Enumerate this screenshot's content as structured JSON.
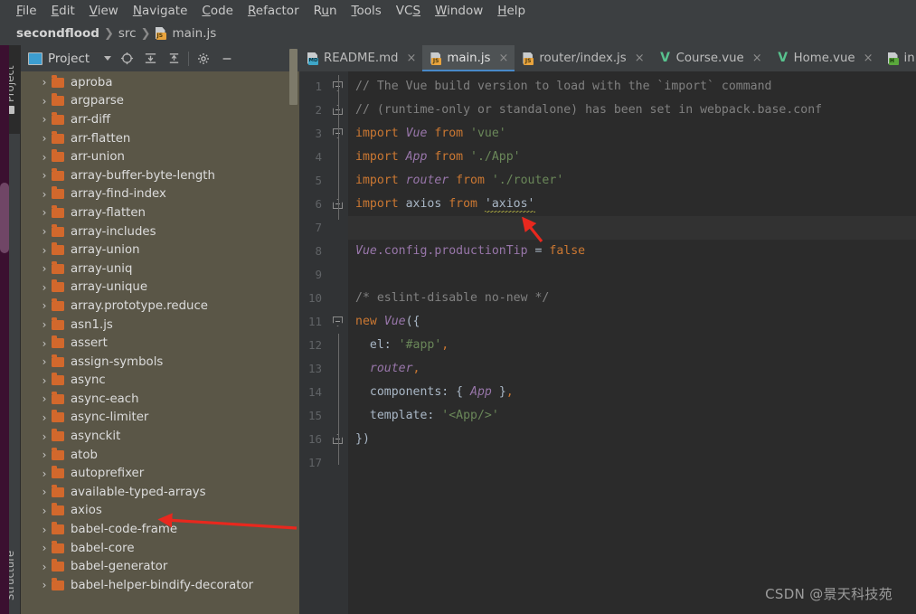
{
  "window": {
    "theme_bg": "#3c3f41",
    "editor_bg": "#2b2b2b",
    "accent": "#4989c8"
  },
  "menubar": {
    "items": [
      {
        "label": "File",
        "accel": "F"
      },
      {
        "label": "Edit",
        "accel": "E"
      },
      {
        "label": "View",
        "accel": "V"
      },
      {
        "label": "Navigate",
        "accel": "N"
      },
      {
        "label": "Code",
        "accel": "C"
      },
      {
        "label": "Refactor",
        "accel": "R"
      },
      {
        "label": "Run",
        "accel": "u"
      },
      {
        "label": "Tools",
        "accel": "T"
      },
      {
        "label": "VCS",
        "accel": "S"
      },
      {
        "label": "Window",
        "accel": "W"
      },
      {
        "label": "Help",
        "accel": "H"
      }
    ]
  },
  "breadcrumb": {
    "project": "secondflood",
    "folder": "src",
    "file": "main.js",
    "file_icon": "js-file-icon",
    "separator": "❯"
  },
  "toolwindow_strip": {
    "project_tab": "Project",
    "structure_tab": "Structure"
  },
  "project_panel": {
    "title": "Project",
    "toolbar_icons": [
      "select-opened-file-icon",
      "expand-all-icon",
      "collapse-all-icon",
      "settings-gear-icon",
      "hide-panel-icon"
    ],
    "tree": [
      {
        "label": "aproba",
        "icon": "folder-icon",
        "expanded": false
      },
      {
        "label": "argparse",
        "icon": "folder-icon",
        "expanded": false
      },
      {
        "label": "arr-diff",
        "icon": "folder-icon",
        "expanded": false
      },
      {
        "label": "arr-flatten",
        "icon": "folder-icon",
        "expanded": false
      },
      {
        "label": "arr-union",
        "icon": "folder-icon",
        "expanded": false
      },
      {
        "label": "array-buffer-byte-length",
        "icon": "folder-icon",
        "expanded": false
      },
      {
        "label": "array-find-index",
        "icon": "folder-icon",
        "expanded": false
      },
      {
        "label": "array-flatten",
        "icon": "folder-icon",
        "expanded": false
      },
      {
        "label": "array-includes",
        "icon": "folder-icon",
        "expanded": false
      },
      {
        "label": "array-union",
        "icon": "folder-icon",
        "expanded": false
      },
      {
        "label": "array-uniq",
        "icon": "folder-icon",
        "expanded": false
      },
      {
        "label": "array-unique",
        "icon": "folder-icon",
        "expanded": false
      },
      {
        "label": "array.prototype.reduce",
        "icon": "folder-icon",
        "expanded": false
      },
      {
        "label": "asn1.js",
        "icon": "folder-icon",
        "expanded": false
      },
      {
        "label": "assert",
        "icon": "folder-icon",
        "expanded": false
      },
      {
        "label": "assign-symbols",
        "icon": "folder-icon",
        "expanded": false
      },
      {
        "label": "async",
        "icon": "folder-icon",
        "expanded": false
      },
      {
        "label": "async-each",
        "icon": "folder-icon",
        "expanded": false
      },
      {
        "label": "async-limiter",
        "icon": "folder-icon",
        "expanded": false
      },
      {
        "label": "asynckit",
        "icon": "folder-icon",
        "expanded": false
      },
      {
        "label": "atob",
        "icon": "folder-icon",
        "expanded": false
      },
      {
        "label": "autoprefixer",
        "icon": "folder-icon",
        "expanded": false
      },
      {
        "label": "available-typed-arrays",
        "icon": "folder-icon",
        "expanded": false
      },
      {
        "label": "axios",
        "icon": "folder-icon",
        "expanded": false
      },
      {
        "label": "babel-code-frame",
        "icon": "folder-icon",
        "expanded": false
      },
      {
        "label": "babel-core",
        "icon": "folder-icon",
        "expanded": false
      },
      {
        "label": "babel-generator",
        "icon": "folder-icon",
        "expanded": false
      },
      {
        "label": "babel-helper-bindify-decorator",
        "icon": "folder-icon",
        "expanded": false
      }
    ]
  },
  "editor_tabs": [
    {
      "label": "README.md",
      "icon": "md-file-icon",
      "active": false,
      "closable": true
    },
    {
      "label": "main.js",
      "icon": "js-file-icon",
      "active": true,
      "closable": true
    },
    {
      "label": "router/index.js",
      "icon": "js-file-icon",
      "active": false,
      "closable": true
    },
    {
      "label": "Course.vue",
      "icon": "vue-file-icon",
      "active": false,
      "closable": true
    },
    {
      "label": "Home.vue",
      "icon": "vue-file-icon",
      "active": false,
      "closable": true
    },
    {
      "label": "in",
      "icon": "html-file-icon",
      "active": false,
      "closable": false
    }
  ],
  "code": {
    "line_numbers": [
      "1",
      "2",
      "3",
      "4",
      "5",
      "6",
      "7",
      "8",
      "9",
      "10",
      "11",
      "12",
      "13",
      "14",
      "15",
      "16",
      "17"
    ],
    "current_line": 7,
    "lines": [
      {
        "n": 1,
        "fold": "arrow-dn",
        "tokens": [
          {
            "t": "// The Vue build version to load with the `import` command",
            "c": "t-com"
          }
        ]
      },
      {
        "n": 2,
        "fold": "arrow-up",
        "tokens": [
          {
            "t": "// (runtime-only or standalone) has been set in webpack.base.conf ",
            "c": "t-com"
          }
        ]
      },
      {
        "n": 3,
        "fold": "arrow-dn",
        "tokens": [
          {
            "t": "import ",
            "c": "t-kw"
          },
          {
            "t": "Vue",
            "c": "t-cls"
          },
          {
            "t": " from ",
            "c": "t-kw"
          },
          {
            "t": "'vue'",
            "c": "t-str"
          }
        ]
      },
      {
        "n": 4,
        "fold": "",
        "tokens": [
          {
            "t": "import ",
            "c": "t-kw"
          },
          {
            "t": "App",
            "c": "t-cls"
          },
          {
            "t": " from ",
            "c": "t-kw"
          },
          {
            "t": "'./App'",
            "c": "t-str"
          }
        ]
      },
      {
        "n": 5,
        "fold": "",
        "tokens": [
          {
            "t": "import ",
            "c": "t-kw"
          },
          {
            "t": "router",
            "c": "t-cls"
          },
          {
            "t": " from ",
            "c": "t-kw"
          },
          {
            "t": "'./router'",
            "c": "t-str"
          }
        ]
      },
      {
        "n": 6,
        "fold": "arrow-up",
        "tokens": [
          {
            "t": "import ",
            "c": "t-kw"
          },
          {
            "t": "axios",
            "c": "t-plain"
          },
          {
            "t": " from ",
            "c": "t-kw"
          },
          {
            "t": "'axios'",
            "c": "t-plain squig"
          }
        ]
      },
      {
        "n": 7,
        "fold": "",
        "tokens": [
          {
            "t": "",
            "c": "t-plain"
          }
        ]
      },
      {
        "n": 8,
        "fold": "",
        "tokens": [
          {
            "t": "Vue",
            "c": "t-cls"
          },
          {
            "t": ".config.productionTip",
            "c": "t-field"
          },
          {
            "t": " = ",
            "c": "t-op"
          },
          {
            "t": "false",
            "c": "t-kw"
          }
        ]
      },
      {
        "n": 9,
        "fold": "",
        "tokens": [
          {
            "t": "",
            "c": "t-plain"
          }
        ]
      },
      {
        "n": 10,
        "fold": "",
        "tokens": [
          {
            "t": "/* eslint-disable no-new */",
            "c": "t-com"
          }
        ]
      },
      {
        "n": 11,
        "fold": "arrow-dn",
        "tokens": [
          {
            "t": "new ",
            "c": "t-kw"
          },
          {
            "t": "Vue",
            "c": "t-cls"
          },
          {
            "t": "({",
            "c": "t-op"
          }
        ]
      },
      {
        "n": 12,
        "fold": "",
        "tokens": [
          {
            "t": "  el",
            "c": "t-plain"
          },
          {
            "t": ": ",
            "c": "t-op"
          },
          {
            "t": "'#app'",
            "c": "t-str"
          },
          {
            "t": ",",
            "c": "t-kw"
          }
        ]
      },
      {
        "n": 13,
        "fold": "",
        "tokens": [
          {
            "t": "  ",
            "c": "t-plain"
          },
          {
            "t": "router",
            "c": "t-cls"
          },
          {
            "t": ",",
            "c": "t-kw"
          }
        ]
      },
      {
        "n": 14,
        "fold": "",
        "tokens": [
          {
            "t": "  components",
            "c": "t-plain"
          },
          {
            "t": ": { ",
            "c": "t-op"
          },
          {
            "t": "App",
            "c": "t-cls"
          },
          {
            "t": " }",
            "c": "t-op"
          },
          {
            "t": ",",
            "c": "t-kw"
          }
        ]
      },
      {
        "n": 15,
        "fold": "",
        "tokens": [
          {
            "t": "  template",
            "c": "t-plain"
          },
          {
            "t": ": ",
            "c": "t-op"
          },
          {
            "t": "'<App/>'",
            "c": "t-str"
          }
        ]
      },
      {
        "n": 16,
        "fold": "arrow-up",
        "tokens": [
          {
            "t": "})",
            "c": "t-op"
          }
        ]
      },
      {
        "n": 17,
        "fold": "",
        "tokens": [
          {
            "t": "",
            "c": "t-plain"
          }
        ]
      }
    ]
  },
  "annotations": [
    {
      "name": "arrow-pointing-to-axios-import",
      "color": "#e8281e",
      "target": "'axios' string on line 6"
    },
    {
      "name": "arrow-pointing-to-axios-folder",
      "color": "#e8281e",
      "target": "axios folder in project tree"
    }
  ],
  "watermark": {
    "text": "CSDN @景天科技苑"
  }
}
